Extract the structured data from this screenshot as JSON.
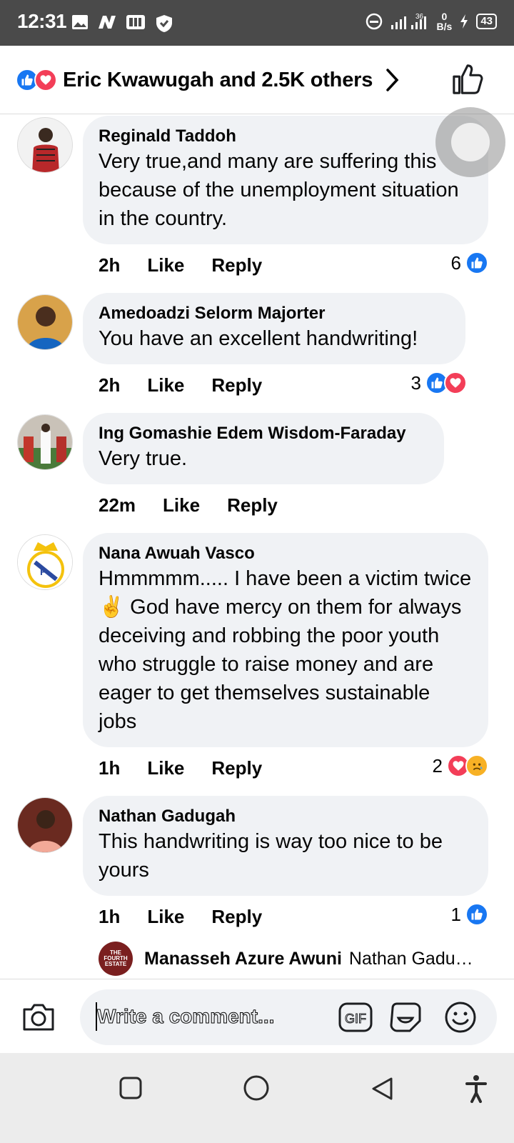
{
  "status_bar": {
    "time": "12:31",
    "network": "36",
    "speed_value": "0",
    "speed_unit": "B/s",
    "battery": "43"
  },
  "header": {
    "reactions_text": "Eric Kwawugah and 2.5K others"
  },
  "comments": [
    {
      "author": "Reginald Taddoh",
      "text": "Very true,and many are suffering this because of the unemployment situation in the country.",
      "time": "2h",
      "like_label": "Like",
      "reply_label": "Reply",
      "reaction_count": "6"
    },
    {
      "author": "Amedoadzi Selorm Majorter",
      "text": "You have an excellent handwriting!",
      "time": "2h",
      "like_label": "Like",
      "reply_label": "Reply",
      "reaction_count": "3"
    },
    {
      "author": "Ing Gomashie Edem Wisdom-Faraday",
      "text": "Very true.",
      "time": "22m",
      "like_label": "Like",
      "reply_label": "Reply",
      "reaction_count": ""
    },
    {
      "author": "Nana Awuah Vasco",
      "text": "Hmmmmm..... I have been a victim twice ✌️ God have mercy on them for always deceiving and robbing the poor youth who struggle to raise money and are eager to get themselves sustainable jobs",
      "time": "1h",
      "like_label": "Like",
      "reply_label": "Reply",
      "reaction_count": "2"
    },
    {
      "author": "Nathan Gadugah",
      "text": "This handwriting is way too nice to be yours",
      "time": "1h",
      "like_label": "Like",
      "reply_label": "Reply",
      "reaction_count": "1"
    }
  ],
  "reply_preview": {
    "author": "Manasseh Azure Awuni",
    "text": "Nathan Gadu…",
    "avatar_text": "THE FOURTH ESTATE"
  },
  "composer": {
    "placeholder": "Write a comment...",
    "gif_label": "GIF"
  },
  "colors": {
    "like_blue": "#1877f2",
    "love_red": "#f33e58",
    "bubble_grey": "#f0f2f5"
  },
  "icons": [
    "like-icon",
    "love-icon",
    "sad-icon",
    "chevron-right-icon",
    "thumbs-up-icon",
    "camera-icon",
    "gif-icon",
    "sticker-icon",
    "emoji-icon",
    "square-nav-icon",
    "circle-nav-icon",
    "back-nav-icon",
    "accessibility-icon"
  ]
}
